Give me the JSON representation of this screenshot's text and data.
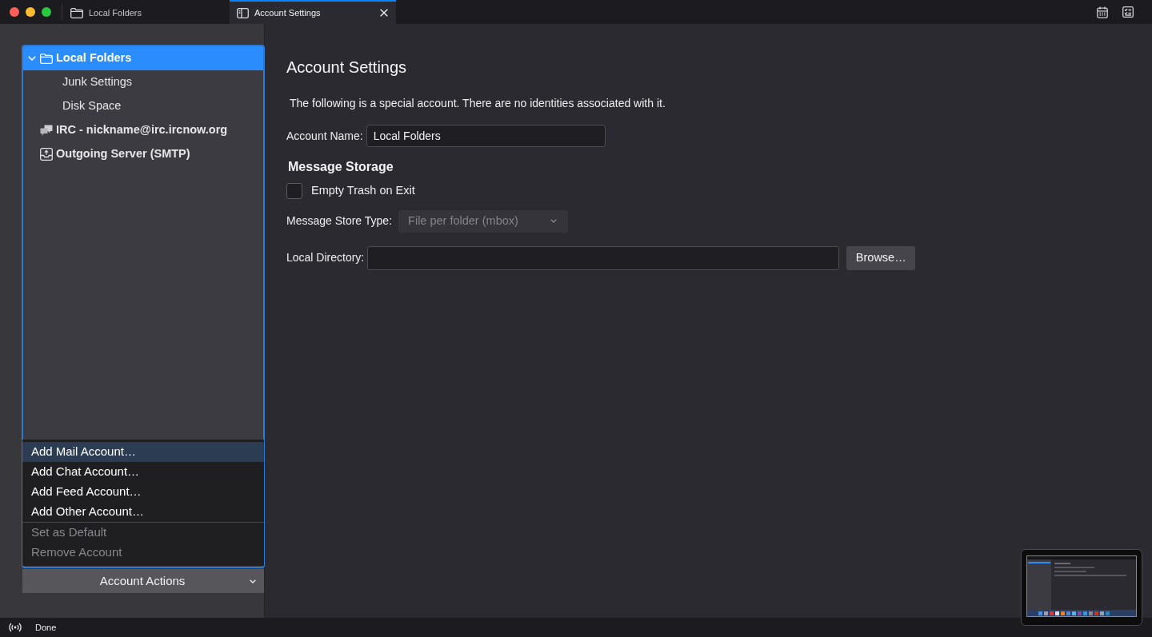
{
  "tabs": [
    {
      "label": "Local Folders",
      "kind": "folder",
      "selected": false,
      "closable": false
    },
    {
      "label": "Account Settings",
      "kind": "settings",
      "selected": true,
      "closable": true
    }
  ],
  "sidebar": {
    "tree": [
      {
        "label": "Local Folders",
        "kind": "folder",
        "selected": true,
        "expanded": true,
        "children": [
          {
            "label": "Junk Settings",
            "selected": false
          },
          {
            "label": "Disk Space",
            "selected": false
          }
        ]
      },
      {
        "label": "IRC - nickname@irc.ircnow.org",
        "kind": "chat",
        "selected": false
      },
      {
        "label": "Outgoing Server (SMTP)",
        "kind": "outgoing",
        "selected": false
      }
    ],
    "account_actions_menu": {
      "groups": [
        {
          "items": [
            {
              "label": "Add Mail Account…",
              "highlighted": true,
              "disabled": false
            },
            {
              "label": "Add Chat Account…",
              "highlighted": false,
              "disabled": false
            },
            {
              "label": "Add Feed Account…",
              "highlighted": false,
              "disabled": false
            },
            {
              "label": "Add Other Account…",
              "highlighted": false,
              "disabled": false
            }
          ]
        },
        {
          "items": [
            {
              "label": "Set as Default",
              "highlighted": false,
              "disabled": true
            },
            {
              "label": "Remove Account",
              "highlighted": false,
              "disabled": true
            }
          ]
        }
      ]
    },
    "account_actions_button": {
      "label": "Account Actions"
    }
  },
  "content": {
    "title": "Account Settings",
    "description": "The following is a special account. There are no identities associated with it.",
    "account_name": {
      "label": "Account Name:",
      "value": "Local Folders"
    },
    "message_storage": {
      "heading": "Message Storage",
      "empty_trash": {
        "label": "Empty Trash on Exit",
        "checked": false
      },
      "store_type": {
        "label": "Message Store Type:",
        "value": "File per folder (mbox)",
        "disabled": true
      },
      "local_directory": {
        "label": "Local Directory:"
      },
      "browse_button": {
        "label": "Browse…"
      }
    }
  },
  "status_bar": {
    "text": "Done"
  }
}
